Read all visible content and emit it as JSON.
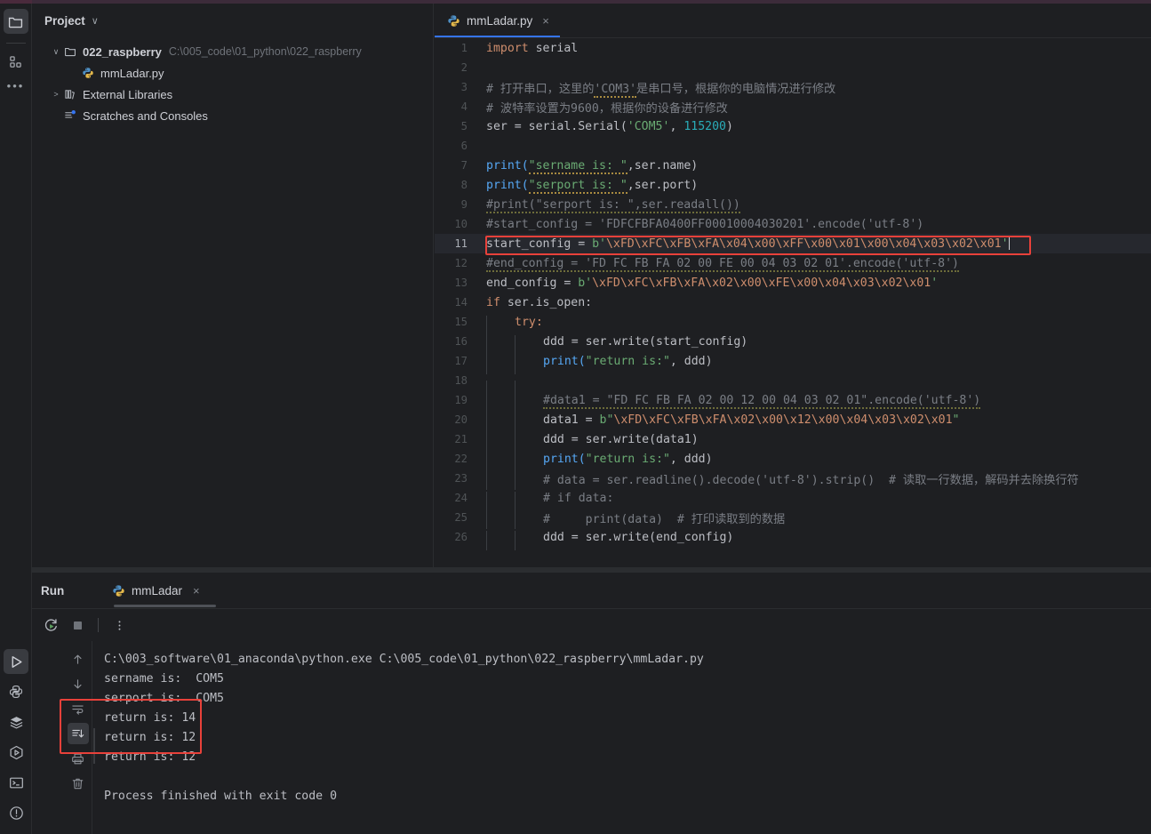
{
  "app": {
    "theme_bg": "#1e1f22",
    "accent": "#3574f0",
    "highlight_color": "#e8413a"
  },
  "left_rail": {
    "top_items": [
      {
        "name": "project-tool-window",
        "icon": "folder-icon",
        "label": "Project",
        "active": true
      },
      {
        "name": "structure-tool-window",
        "icon": "structure-icon",
        "label": "Structure",
        "active": false
      },
      {
        "name": "more-tool-windows",
        "icon": "more-dots-icon",
        "label": "More",
        "active": false
      }
    ],
    "bottom_items": [
      {
        "name": "run-tool-window",
        "icon": "run-triangle-icon",
        "label": "Run",
        "active": true
      },
      {
        "name": "python-packages-tool-window",
        "icon": "python-icon",
        "label": "Python Packages",
        "active": false
      },
      {
        "name": "python-console-tool-window",
        "icon": "layers-icon",
        "label": "Python Console",
        "active": false
      },
      {
        "name": "services-tool-window",
        "icon": "hexagon-play-icon",
        "label": "Services",
        "active": false
      },
      {
        "name": "terminal-tool-window",
        "icon": "terminal-icon",
        "label": "Terminal",
        "active": false
      },
      {
        "name": "problems-tool-window",
        "icon": "warning-circle-icon",
        "label": "Problems",
        "active": false
      }
    ]
  },
  "project_panel": {
    "title": "Project",
    "dropdown_glyph": "∨",
    "tree": [
      {
        "name": "project-root-node",
        "arrow": "∨",
        "icon": "folder-icon",
        "label": "022_raspberry",
        "bold": true,
        "path": "C:\\005_code\\01_python\\022_raspberry",
        "indent": 0
      },
      {
        "name": "file-node-mmladar",
        "arrow": "",
        "icon": "python-file-icon",
        "label": "mmLadar.py",
        "bold": false,
        "path": "",
        "indent": 1
      },
      {
        "name": "external-libraries-node",
        "arrow": ">",
        "icon": "library-icon",
        "label": "External Libraries",
        "bold": false,
        "path": "",
        "indent": 0
      },
      {
        "name": "scratches-consoles-node",
        "arrow": "",
        "icon": "scratches-icon",
        "label": "Scratches and Consoles",
        "bold": false,
        "path": "",
        "indent": 0
      }
    ]
  },
  "editor": {
    "tab": {
      "label": "mmLadar.py",
      "icon": "python-file-icon",
      "close_glyph": "×"
    },
    "current_line": 11,
    "lines": [
      {
        "n": "1",
        "indent": 0
      },
      {
        "n": "2",
        "indent": 0
      },
      {
        "n": "3",
        "indent": 0
      },
      {
        "n": "4",
        "indent": 0
      },
      {
        "n": "5",
        "indent": 0
      },
      {
        "n": "6",
        "indent": 0
      },
      {
        "n": "7",
        "indent": 0
      },
      {
        "n": "8",
        "indent": 0
      },
      {
        "n": "9",
        "indent": 0
      },
      {
        "n": "10",
        "indent": 0
      },
      {
        "n": "11",
        "indent": 0
      },
      {
        "n": "12",
        "indent": 0
      },
      {
        "n": "13",
        "indent": 0
      },
      {
        "n": "14",
        "indent": 0
      },
      {
        "n": "15",
        "indent": 1
      },
      {
        "n": "16",
        "indent": 2
      },
      {
        "n": "17",
        "indent": 2
      },
      {
        "n": "18",
        "indent": 2
      },
      {
        "n": "19",
        "indent": 2
      },
      {
        "n": "20",
        "indent": 2
      },
      {
        "n": "21",
        "indent": 2
      },
      {
        "n": "22",
        "indent": 2
      },
      {
        "n": "23",
        "indent": 2
      },
      {
        "n": "24",
        "indent": 2
      },
      {
        "n": "25",
        "indent": 2
      },
      {
        "n": "26",
        "indent": 2
      }
    ],
    "code_text": {
      "l1_import": "import",
      "l1_mod": " serial",
      "l3": "# 打开串口，这里的'COM3'是串口号，根据你的电脑情况进行修改",
      "l3a": "# 打开串口，这里的",
      "l3b": "'COM3'",
      "l3c": "是串口号，根据你的电脑情况进行修改",
      "l4": "# 波特率设置为9600，根据你的设备进行修改",
      "l5a": "ser = serial.Serial(",
      "l5b": "'COM5'",
      "l5c": ", ",
      "l5d": "115200",
      "l5e": ")",
      "l7a": "print(",
      "l7b": "\"sername is: \"",
      "l7c": ",ser.name)",
      "l8b": "\"serport is: \"",
      "l8c": ",ser.port)",
      "l9": "#print(\"serport is: \",ser.readall())",
      "l10": "#start_config = 'FDFCFBFA0400FF00010004030201'.encode('utf-8')",
      "l11a": "start_config = ",
      "l11b": "b'",
      "l11c": "\\xFD\\xFC\\xFB\\xFA\\x04\\x00\\xFF\\x00\\x01\\x00\\x04\\x03\\x02\\x01",
      "l11d": "'",
      "l12": "#end_config = 'FD FC FB FA 02 00 FE 00 04 03 02 01'.encode('utf-8')",
      "l13a": "end_config = ",
      "l13b": "b'",
      "l13c": "\\xFD\\xFC\\xFB\\xFA\\x02\\x00\\xFE\\x00\\x04\\x03\\x02\\x01",
      "l13d": "'",
      "l14a": "if",
      "l14b": " ser.is_open:",
      "l15": "try:",
      "l16": "ddd = ser.write(start_config)",
      "l17a": "print(",
      "l17b": "\"return is:\"",
      "l17c": ", ddd)",
      "l19": "#data1 = \"FD FC FB FA 02 00 12 00 04 03 02 01\".encode('utf-8')",
      "l20a": "data1 = ",
      "l20b": "b\"",
      "l20c": "\\xFD\\xFC\\xFB\\xFA\\x02\\x00\\x12\\x00\\x04\\x03\\x02\\x01",
      "l20d": "\"",
      "l21": "ddd = ser.write(data1)",
      "l22a": "print(",
      "l22b": "\"return is:\"",
      "l22c": ", ddd)",
      "l23a": "# data = ser.readline().decode('utf-8').strip()",
      "l23b": "  # 读取一行数据，解码并去除换行符",
      "l24": "# if data:",
      "l25": "#     print(data)  # 打印读取到的数据",
      "l26": "ddd = ser.write(end_config)"
    }
  },
  "run_panel": {
    "title": "Run",
    "tab": {
      "label": "mmLadar",
      "icon": "python-file-icon",
      "close_glyph": "×"
    },
    "toolbar": [
      {
        "name": "rerun-button",
        "icon": "rerun-icon",
        "label": "Rerun"
      },
      {
        "name": "stop-button",
        "icon": "stop-square-icon",
        "label": "Stop"
      },
      {
        "name": "more-options-button",
        "icon": "vertical-dots-icon",
        "label": "More"
      }
    ],
    "side_toolbar": [
      {
        "name": "scroll-up-button",
        "icon": "arrow-up-icon",
        "label": "Up",
        "active": false
      },
      {
        "name": "scroll-down-button",
        "icon": "arrow-down-icon",
        "label": "Down",
        "active": false
      },
      {
        "name": "soft-wrap-button",
        "icon": "soft-wrap-icon",
        "label": "Soft-Wrap",
        "active": false
      },
      {
        "name": "scroll-to-end-button",
        "icon": "scroll-to-end-icon",
        "label": "Scroll to End",
        "active": true
      },
      {
        "name": "print-button",
        "icon": "printer-icon",
        "label": "Print",
        "active": false
      },
      {
        "name": "clear-all-button",
        "icon": "trash-icon",
        "label": "Clear All",
        "active": false
      }
    ],
    "console_lines": [
      "C:\\003_software\\01_anaconda\\python.exe C:\\005_code\\01_python\\022_raspberry\\mmLadar.py",
      "sername is:  COM5",
      "serport is:  COM5",
      "return is: 14",
      "return is: 12",
      "return is: 12",
      "",
      "Process finished with exit code 0"
    ]
  },
  "annotations": [
    {
      "name": "code-highlight-box",
      "target": "editor line 11",
      "color": "#e8413a"
    },
    {
      "name": "console-highlight-box",
      "target": "console return is lines",
      "color": "#e8413a"
    }
  ]
}
